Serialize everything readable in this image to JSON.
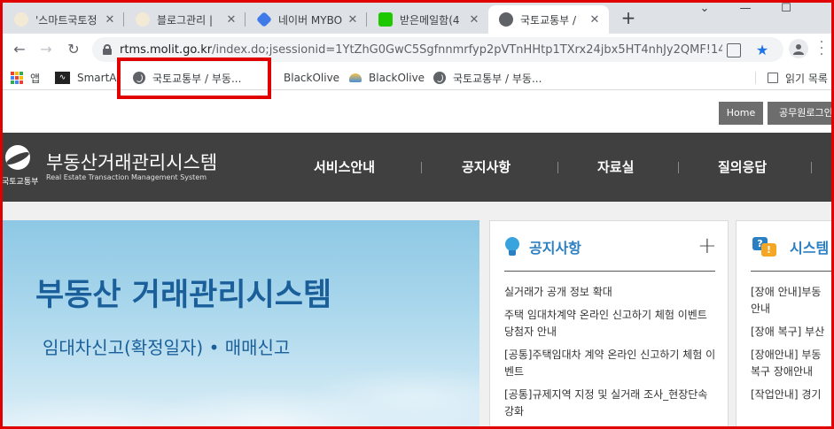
{
  "tabs": [
    {
      "label": "'스마트국토정",
      "icon": "blog-icon"
    },
    {
      "label": "블로그관리 |",
      "icon": "blog-icon"
    },
    {
      "label": "네이버 MYBO",
      "icon": "mybox-icon"
    },
    {
      "label": "받은메일함(4",
      "icon": "mail-icon"
    },
    {
      "label": "국토교통부 /",
      "icon": "globe-icon"
    }
  ],
  "new_tab_label": "+",
  "window_controls": {
    "minimize": "⌄",
    "restore": "—",
    "maximize": "☐"
  },
  "address": {
    "domain": "rtms.molit.go.kr",
    "path": "/index.do;jsessionid=1YtZhG0GwC5Sgfnnmrfyp2pVTnHHtp1TXrx24jbx5HT4nhJy2QMF!14..."
  },
  "bookmarks": [
    {
      "label": "앱",
      "icon": "apps-icon"
    },
    {
      "label": "SmartAL",
      "icon": "smartal-icon"
    },
    {
      "label": "국토교통부 / 부동...",
      "icon": "globe-icon"
    },
    {
      "label": "BlackOlive",
      "icon": "blackolive-icon"
    },
    {
      "label": "BlackOlive",
      "icon": "blackolive-icon"
    },
    {
      "label": "국토교통부 / 부동...",
      "icon": "globe-icon"
    }
  ],
  "reading_list": "읽기 목록",
  "site": {
    "home_button": "Home",
    "login_button": "공무원로그인",
    "ministry_name": "국토교통부",
    "title": "부동산거래관리시스템",
    "subtitle": "Real Estate Transaction Management System",
    "menu": [
      "서비스안내",
      "공지사항",
      "자료실",
      "질의응답"
    ]
  },
  "banner": {
    "title": "부동산 거래관리시스템",
    "subtitle": "임대차신고(확정일자) • 매매신고"
  },
  "notice_panel": {
    "title": "공지사항",
    "more": "+",
    "items": [
      "실거래가 공개 정보 확대",
      "주택 임대차계약 온라인 신고하기 체험 이벤트 당첨자 안내",
      "[공통]주택임대차 계약 온라인 신고하기 체험 이벤트",
      "[공통]규제지역 지정 및 실거래 조사_현장단속 강화"
    ]
  },
  "system_panel": {
    "title": "시스템",
    "items": [
      "[장애 안내]부동 안내",
      "[장애 복구] 부산",
      "[장애안내] 부동 복구 장애안내",
      "[작업안내] 경기"
    ]
  },
  "colors": {
    "highlight_box": "#e00000",
    "gnb_bg": "#404040",
    "accent": "#2b7fc3"
  }
}
